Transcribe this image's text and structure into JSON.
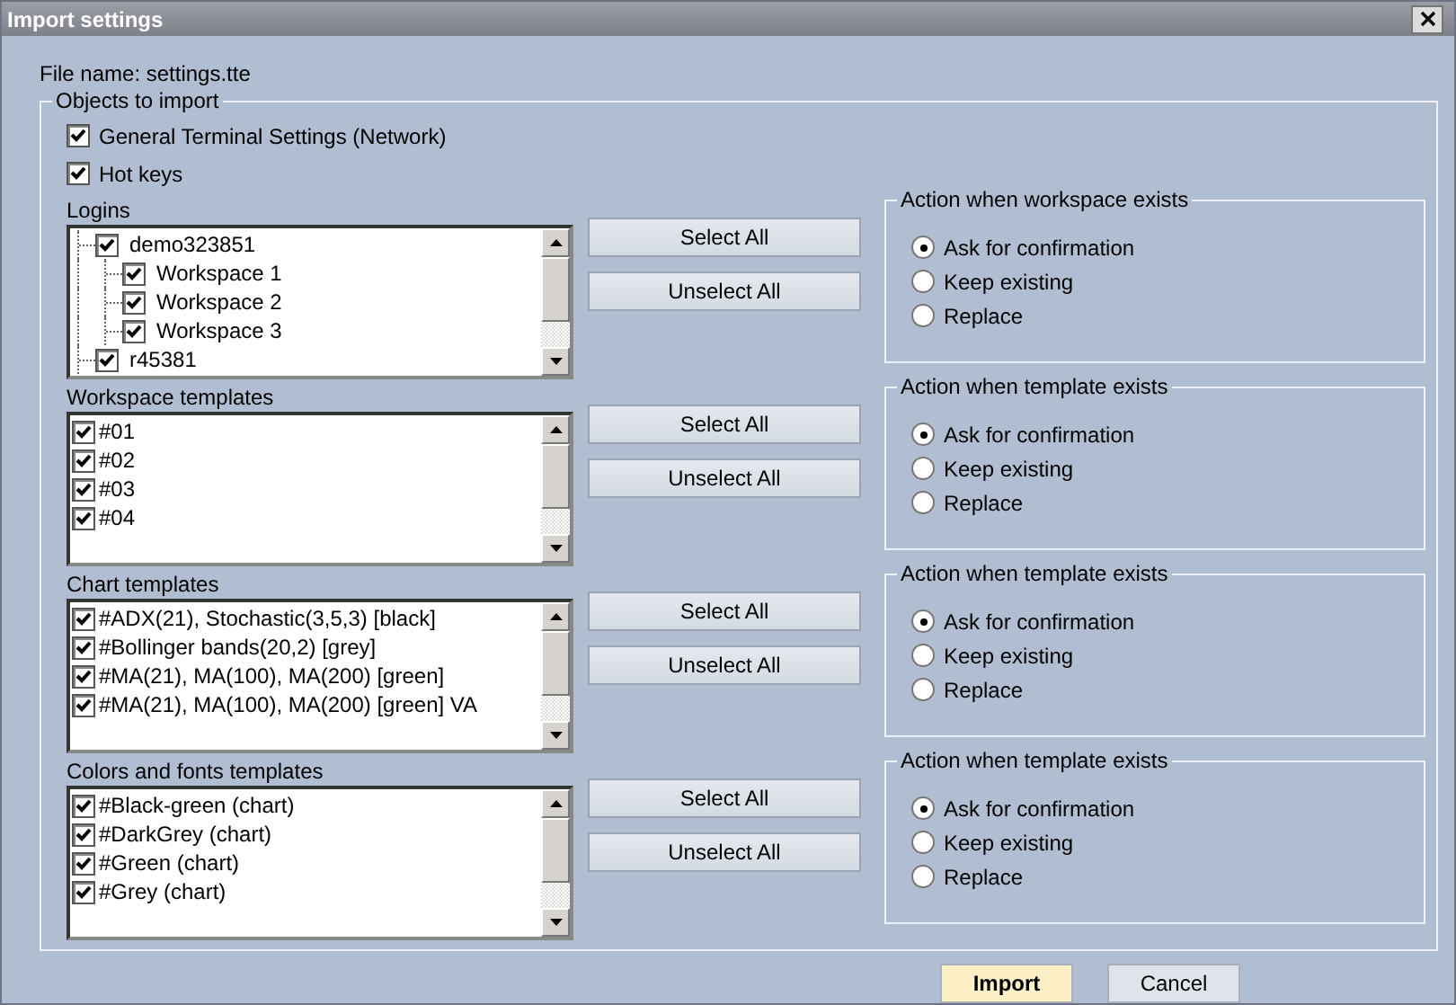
{
  "window": {
    "title": "Import settings"
  },
  "file_name": "File name: settings.tte",
  "objects_group": {
    "title": "Objects to import",
    "options": [
      {
        "label": "General Terminal Settings (Network)",
        "checked": true
      },
      {
        "label": "Hot keys",
        "checked": true
      }
    ],
    "sections": [
      {
        "kind": "tree",
        "heading": "Logins",
        "items": [
          {
            "label": "demo323851",
            "checked": true,
            "children": [
              {
                "label": "Workspace 1",
                "checked": true
              },
              {
                "label": "Workspace 2",
                "checked": true
              },
              {
                "label": "Workspace 3",
                "checked": true
              }
            ]
          },
          {
            "label": "r45381",
            "checked": true
          }
        ],
        "buttons": [
          "Select All",
          "Unselect All"
        ],
        "action_group": {
          "title": "Action when workspace exists",
          "options": [
            {
              "label": "Ask for confirmation",
              "selected": true
            },
            {
              "label": "Keep existing",
              "selected": false
            },
            {
              "label": "Replace",
              "selected": false
            }
          ]
        }
      },
      {
        "kind": "list",
        "heading": "Workspace templates",
        "items": [
          {
            "label": "#01",
            "checked": true
          },
          {
            "label": "#02",
            "checked": true
          },
          {
            "label": "#03",
            "checked": true
          },
          {
            "label": "#04",
            "checked": true
          }
        ],
        "buttons": [
          "Select All",
          "Unselect All"
        ],
        "action_group": {
          "title": "Action when template exists",
          "options": [
            {
              "label": "Ask for confirmation",
              "selected": true
            },
            {
              "label": "Keep existing",
              "selected": false
            },
            {
              "label": "Replace",
              "selected": false
            }
          ]
        }
      },
      {
        "kind": "list",
        "heading": "Chart templates",
        "items": [
          {
            "label": "#ADX(21), Stochastic(3,5,3) [black]",
            "checked": true
          },
          {
            "label": "#Bollinger bands(20,2) [grey]",
            "checked": true
          },
          {
            "label": "#MA(21), MA(100), MA(200) [green]",
            "checked": true
          },
          {
            "label": "#MA(21), MA(100), MA(200) [green] VA",
            "checked": true
          }
        ],
        "buttons": [
          "Select All",
          "Unselect All"
        ],
        "action_group": {
          "title": "Action when template exists",
          "options": [
            {
              "label": "Ask for confirmation",
              "selected": true
            },
            {
              "label": "Keep existing",
              "selected": false
            },
            {
              "label": "Replace",
              "selected": false
            }
          ]
        }
      },
      {
        "kind": "list",
        "heading": "Colors and fonts templates",
        "items": [
          {
            "label": "#Black-green (chart)",
            "checked": true
          },
          {
            "label": "#DarkGrey (chart)",
            "checked": true
          },
          {
            "label": "#Green (chart)",
            "checked": true
          },
          {
            "label": "#Grey (chart)",
            "checked": true
          }
        ],
        "buttons": [
          "Select All",
          "Unselect All"
        ],
        "action_group": {
          "title": "Action when template exists",
          "options": [
            {
              "label": "Ask for confirmation",
              "selected": true
            },
            {
              "label": "Keep existing",
              "selected": false
            },
            {
              "label": "Replace",
              "selected": false
            }
          ]
        }
      }
    ]
  },
  "buttons": [
    {
      "label": "Import",
      "default": true
    },
    {
      "label": "Cancel",
      "default": false
    }
  ]
}
